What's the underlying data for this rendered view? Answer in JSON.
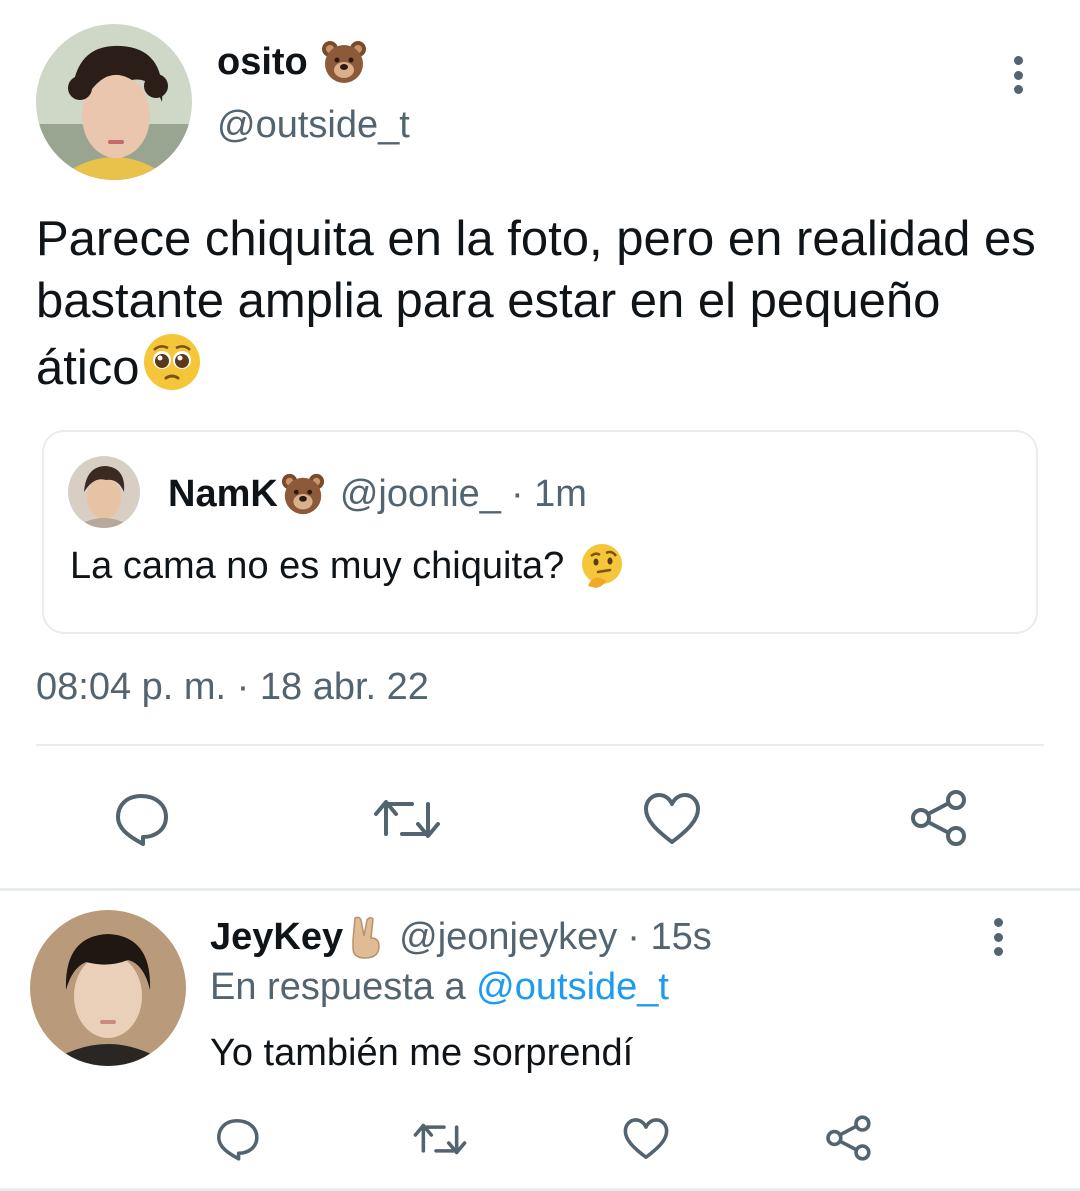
{
  "tweet": {
    "author_name": "osito",
    "author_emoji_icon": "bear-face-icon",
    "author_handle": "@outside_t",
    "text": "Parece chiquita en la foto, pero en realidad es bastante amplia para estar en el pequeño ático",
    "text_emoji_icon": "pleading-face-icon",
    "timestamp": "08:04 p. m. · 18 abr. 22",
    "quoted": {
      "author_name": "NamK",
      "author_emoji_icon": "bear-face-icon",
      "author_handle": "@joonie_",
      "time_ago": "· 1m",
      "text": "La cama no es muy chiquita?",
      "text_emoji_icon": "thinking-face-icon"
    },
    "actions": [
      "reply-icon",
      "retweet-icon",
      "like-icon",
      "share-icon"
    ]
  },
  "reply": {
    "author_name": "JeyKey",
    "author_emoji_icon": "victory-hand-icon",
    "author_handle": "@jeonjeykey",
    "time_ago": "· 15s",
    "replying_prefix": "En respuesta a",
    "replying_to": "@outside_t",
    "text": "Yo también me sorprendí",
    "actions": [
      "reply-icon",
      "retweet-icon",
      "like-icon",
      "share-icon"
    ]
  },
  "colors": {
    "muted": "#536471",
    "link": "#1d9bf0",
    "divider": "#e6ecf0"
  }
}
